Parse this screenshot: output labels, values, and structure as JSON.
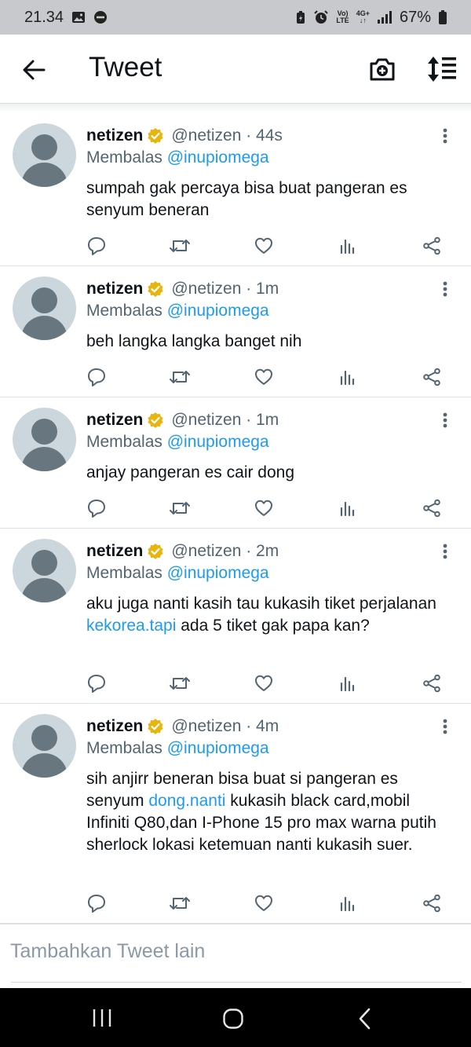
{
  "status_bar": {
    "time": "21.34",
    "battery": "67%",
    "volte_top": "Vo)",
    "volte_bottom": "LTE",
    "network_top": "4G+",
    "network_bottom": "↓↑"
  },
  "header": {
    "title": "Tweet"
  },
  "tweets": [
    {
      "name": "netizen",
      "meta": "@netizen · 44s",
      "reply_prefix": "Membalas",
      "reply_to": "@inupiomega",
      "text": "sumpah gak percaya bisa buat pangeran es senyum beneran"
    },
    {
      "name": "netizen",
      "meta": "@netizen · 1m",
      "reply_prefix": "Membalas",
      "reply_to": "@inupiomega",
      "text": "beh langka langka banget nih"
    },
    {
      "name": "netizen",
      "meta": "@netizen · 1m",
      "reply_prefix": "Membalas",
      "reply_to": "@inupiomega",
      "text": "anjay pangeran es cair dong"
    },
    {
      "name": "netizen",
      "meta": "@netizen · 2m",
      "reply_prefix": "Membalas",
      "reply_to": "@inupiomega",
      "text_parts": {
        "before": "aku juga nanti kasih tau kukasih tiket perjalanan ",
        "link": "kekorea.tapi",
        "after": " ada 5 tiket gak papa kan?"
      }
    },
    {
      "name": "netizen",
      "meta": "@netizen · 4m",
      "reply_prefix": "Membalas",
      "reply_to": "@inupiomega",
      "text_parts": {
        "before": "sih anjirr beneran bisa buat si pangeran es senyum ",
        "link": "dong.nanti",
        "after": " kukasih black card,mobil Infiniti Q80,dan I-Phone 15 pro max warna putih sherlock lokasi ketemuan nanti kukasih suer."
      }
    }
  ],
  "compose": {
    "placeholder": "Tambahkan Tweet lain"
  },
  "colors": {
    "accent": "#1d9bf0",
    "verified": "#e8b50f",
    "muted_text": "#536471",
    "status_bar_bg": "#c7c9cc",
    "navbar_bg": "#000000"
  },
  "icons": {
    "header": [
      "back-arrow-icon",
      "camera-plus-icon",
      "sort-icon"
    ],
    "actions": [
      "reply-icon",
      "retweet-icon",
      "like-icon",
      "stats-icon",
      "share-icon"
    ],
    "navbar": [
      "recents-icon",
      "home-icon",
      "back-icon"
    ]
  }
}
